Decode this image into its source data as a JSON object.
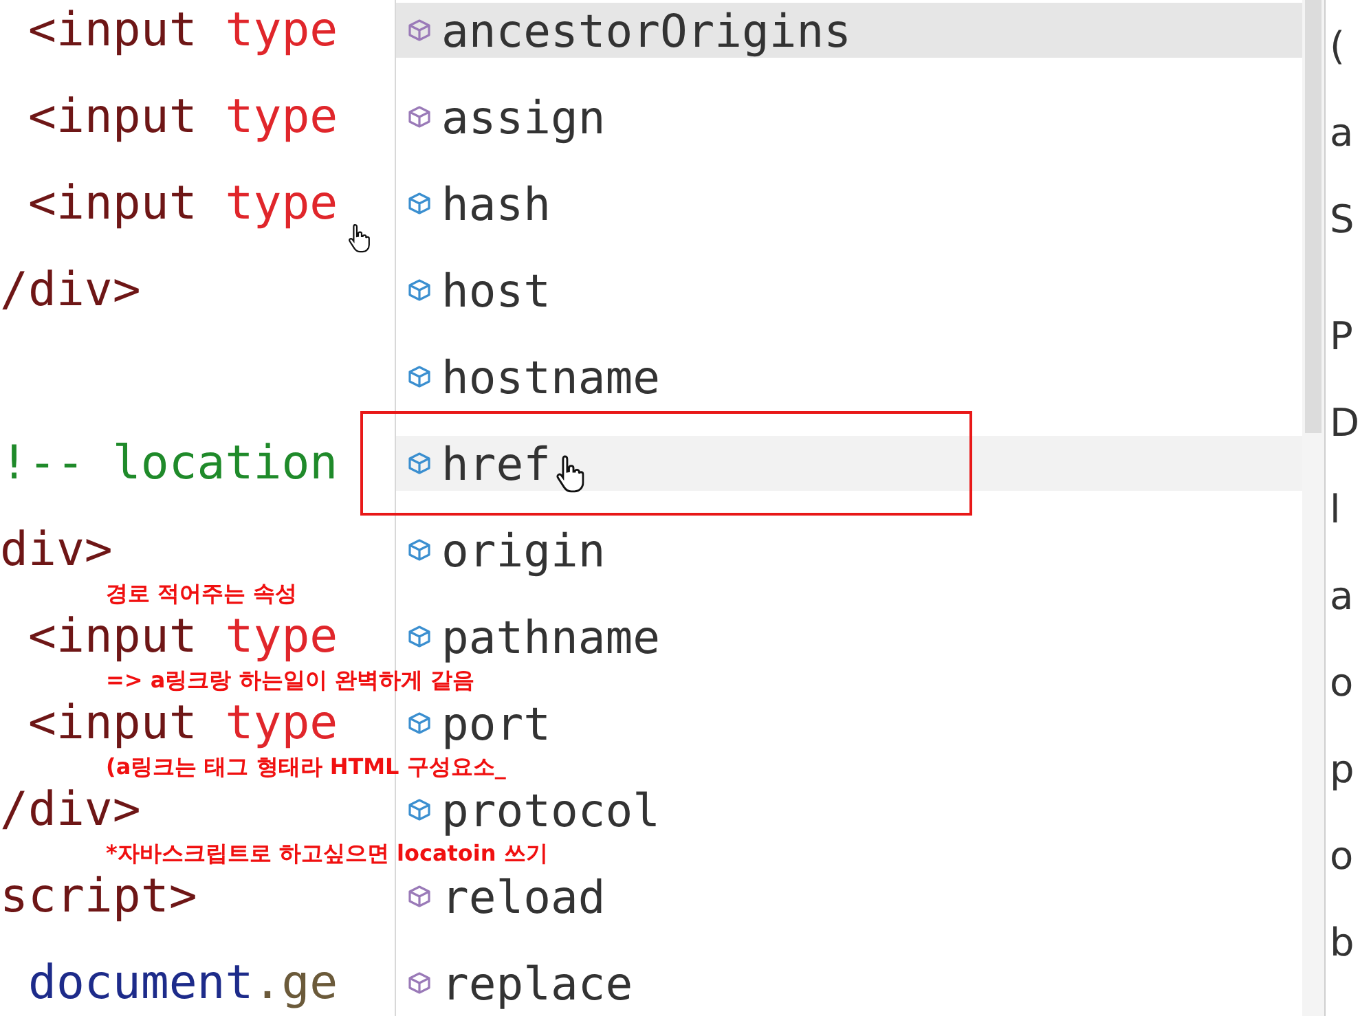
{
  "code_blocks": [
    {
      "lines": [
        {
          "tokens": [
            {
              "kind": "tag",
              "text": " <input "
            },
            {
              "kind": "attr",
              "text": "type"
            }
          ]
        },
        {
          "tokens": [
            {
              "kind": "tag",
              "text": " <input "
            },
            {
              "kind": "attr",
              "text": "type"
            }
          ]
        },
        {
          "tokens": [
            {
              "kind": "tag",
              "text": " <input "
            },
            {
              "kind": "attr",
              "text": "type"
            }
          ]
        },
        {
          "tokens": [
            {
              "kind": "tag",
              "text": "/div>"
            }
          ]
        }
      ]
    },
    {
      "lines": [
        {
          "tokens": [
            {
              "kind": "comment",
              "text": "!-- location"
            }
          ]
        },
        {
          "tokens": [
            {
              "kind": "tag",
              "text": "div>"
            }
          ]
        },
        {
          "tokens": [
            {
              "kind": "tag",
              "text": " <input "
            },
            {
              "kind": "attr",
              "text": "type"
            }
          ]
        },
        {
          "tokens": [
            {
              "kind": "tag",
              "text": " <input "
            },
            {
              "kind": "attr",
              "text": "type"
            }
          ]
        },
        {
          "tokens": [
            {
              "kind": "tag",
              "text": "/div>"
            }
          ]
        },
        {
          "tokens": [
            {
              "kind": "tag",
              "text": "script>"
            }
          ]
        },
        {
          "tokens": [
            {
              "kind": "ident",
              "text": " document"
            },
            {
              "kind": "plain",
              "text": ".ge"
            }
          ]
        }
      ]
    }
  ],
  "suggestions": [
    {
      "label": "ancestorOrigins",
      "kind": "method",
      "selected": true,
      "hovered": false
    },
    {
      "label": "assign",
      "kind": "method",
      "selected": false,
      "hovered": false
    },
    {
      "label": "hash",
      "kind": "property",
      "selected": false,
      "hovered": false
    },
    {
      "label": "host",
      "kind": "property",
      "selected": false,
      "hovered": false
    },
    {
      "label": "hostname",
      "kind": "property",
      "selected": false,
      "hovered": false
    },
    {
      "label": "href",
      "kind": "property",
      "selected": false,
      "hovered": true
    },
    {
      "label": "origin",
      "kind": "property",
      "selected": false,
      "hovered": false
    },
    {
      "label": "pathname",
      "kind": "property",
      "selected": false,
      "hovered": false
    },
    {
      "label": "port",
      "kind": "property",
      "selected": false,
      "hovered": false
    },
    {
      "label": "protocol",
      "kind": "property",
      "selected": false,
      "hovered": false
    },
    {
      "label": "reload",
      "kind": "method",
      "selected": false,
      "hovered": false
    },
    {
      "label": "replace",
      "kind": "method",
      "selected": false,
      "hovered": false
    }
  ],
  "doc_letters": [
    "(",
    "a",
    "S",
    "P",
    "D",
    "l",
    "a",
    "o",
    "p",
    "o",
    "b"
  ],
  "annotation": [
    "경로 적어주는 속성",
    "=> a링크랑 하는일이 완벽하게 같음",
    "(a링크는 태그 형태라 HTML 구성요소_",
    "*자바스크립트로 하고싶으면 locatoin 쓰기"
  ]
}
